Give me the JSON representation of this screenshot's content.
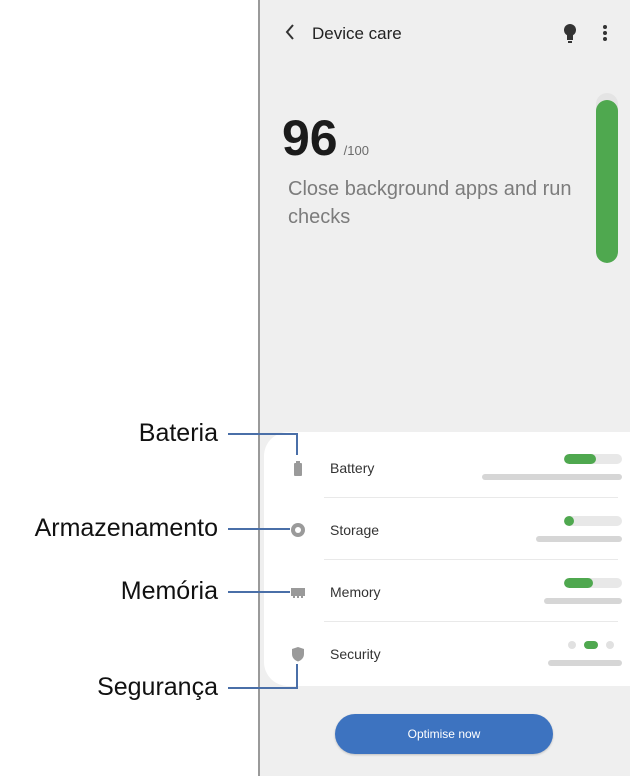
{
  "header": {
    "title": "Device care",
    "back_icon": "chevron-left-icon",
    "bulb_icon": "lightbulb-icon",
    "more_icon": "more-vert-icon"
  },
  "score": {
    "value": "96",
    "max": "/100",
    "level": 0.96,
    "message": "Close background apps and run checks"
  },
  "items": [
    {
      "label": "Battery",
      "icon": "battery-icon",
      "level": 0.55
    },
    {
      "label": "Storage",
      "icon": "storage-icon",
      "level": 0.18
    },
    {
      "label": "Memory",
      "icon": "memory-icon",
      "level": 0.5
    },
    {
      "label": "Security",
      "icon": "shield-icon"
    }
  ],
  "action": {
    "label": "Optimise now"
  },
  "callouts": {
    "battery": "Bateria",
    "storage": "Armazenamento",
    "memory": "Memória",
    "security": "Segurança"
  },
  "colors": {
    "accent_green": "#4fa84f",
    "button_blue": "#3d73c0",
    "screen_bg": "#efefef",
    "leader_line": "#4a6fa8"
  }
}
